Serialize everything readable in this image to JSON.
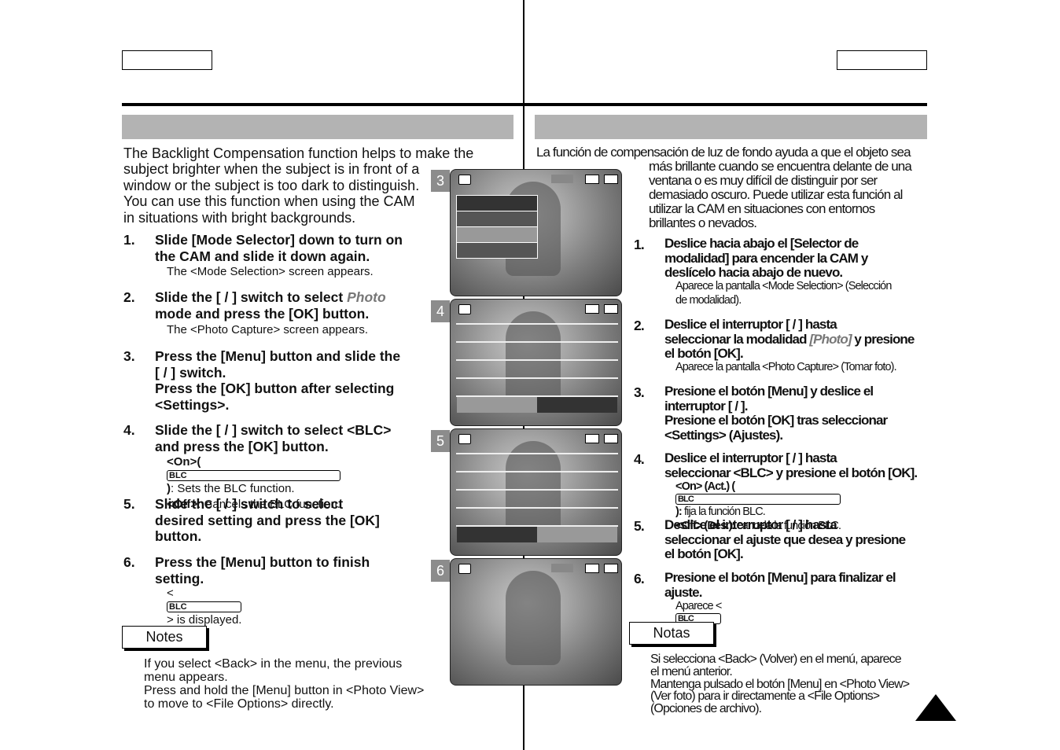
{
  "left": {
    "intro": [
      "The Backlight Compensation function helps to make the",
      "subject brighter when the subject is in front of a",
      "window or the subject is too dark to distinguish.",
      "You can use this function when using the CAM",
      "in situations with bright backgrounds."
    ],
    "steps": [
      {
        "num": "1.",
        "lines": [
          "Slide [Mode Selector] down to turn on",
          "the CAM and slide it down again."
        ],
        "subs": [
          "The <Mode Selection> screen appears."
        ]
      },
      {
        "num": "2.",
        "lines": [
          "Slide the [    /    ] switch to select ",
          "mode and press the [OK] button."
        ],
        "em": "Photo",
        "subs": [
          "The <Photo Capture> screen appears."
        ]
      },
      {
        "num": "3.",
        "lines": [
          "Press the [Menu] button and slide the",
          "[    /    ] switch.",
          "Press the [OK] button after selecting",
          "<Settings>."
        ]
      },
      {
        "num": "4.",
        "lines": [
          "Slide the [    /    ] switch to select <BLC>",
          "and press the [OK] button."
        ],
        "subs": [
          "<On>(",
          ": Sets the BLC function.",
          "<Off>",
          ": Cancels the BLC function."
        ]
      },
      {
        "num": "5.",
        "lines": [
          "Slide the [    /    ] switch to select",
          "desired setting and press the [OK]",
          "button."
        ]
      },
      {
        "num": "6.",
        "lines": [
          "Press the [Menu] button to finish",
          "setting."
        ],
        "subs": [
          "<",
          "> is displayed."
        ]
      }
    ],
    "notes_label": "Notes",
    "notes": [
      "If you select <Back> in the menu, the previous",
      "menu appears.",
      "Press and hold the [Menu] button in <Photo View>",
      "to move to <File Options> directly."
    ]
  },
  "right": {
    "intro": [
      "La función de compensación de luz de fondo ayuda a que el objeto sea",
      "más brillante cuando se encuentra delante de una",
      "ventana o es muy difícil de distinguir por ser",
      "demasiado oscuro. Puede utilizar esta función al",
      "utilizar la CAM en situaciones con entornos",
      "brillantes o nevados."
    ],
    "steps": [
      {
        "num": "1.",
        "lines": [
          "Deslice hacia abajo el [Selector de",
          "modalidad] para encender la CAM y",
          "deslícelo hacia abajo de nuevo."
        ],
        "subs": [
          "Aparece la pantalla <Mode Selection> (Selección",
          "de modalidad)."
        ]
      },
      {
        "num": "2.",
        "lines": [
          "Deslice el interruptor [    /    ] hasta",
          "seleccionar la modalidad ",
          " y presione",
          "el botón [OK]."
        ],
        "em": "[Photo]",
        "subs": [
          "Aparece la pantalla <Photo Capture> (Tomar foto)."
        ]
      },
      {
        "num": "3.",
        "lines": [
          "Presione el botón [Menu] y deslice el",
          "interruptor [    /    ].",
          "Presione el botón [OK] tras seleccionar",
          "<Settings> (Ajustes)."
        ]
      },
      {
        "num": "4.",
        "lines": [
          "Deslice el interruptor [    /    ] hasta",
          "seleccionar <BLC> y presione el botón [OK]."
        ],
        "subs": [
          "<On> (Act.) ( ",
          "): ",
          "fija la función BLC.",
          "<Off> (Des.):",
          " cancela la función BLC."
        ]
      },
      {
        "num": "5.",
        "lines": [
          "Deslice el interruptor [    /    ] hasta",
          "seleccionar el ajuste que desea y presione",
          "el botón [OK]."
        ]
      },
      {
        "num": "6.",
        "lines": [
          "Presione el botón [Menu] para finalizar el",
          "ajuste."
        ],
        "subs": [
          "Aparece < ",
          " >."
        ]
      }
    ],
    "notes_label": "Notas",
    "notes": [
      "Si selecciona <Back> (Volver) en el menú, aparece",
      "el menú anterior.",
      "Mantenga pulsado el botón [Menu] en <Photo View>",
      "(Ver foto) para ir directamente a <File Options>",
      "(Opciones de archivo)."
    ]
  },
  "blc_icon": "BLC",
  "photos": [
    {
      "label": "3"
    },
    {
      "label": "4"
    },
    {
      "label": "5"
    },
    {
      "label": "6"
    }
  ],
  "colors": {
    "band": "#b3b3b3",
    "accent_italic": "#777777"
  }
}
